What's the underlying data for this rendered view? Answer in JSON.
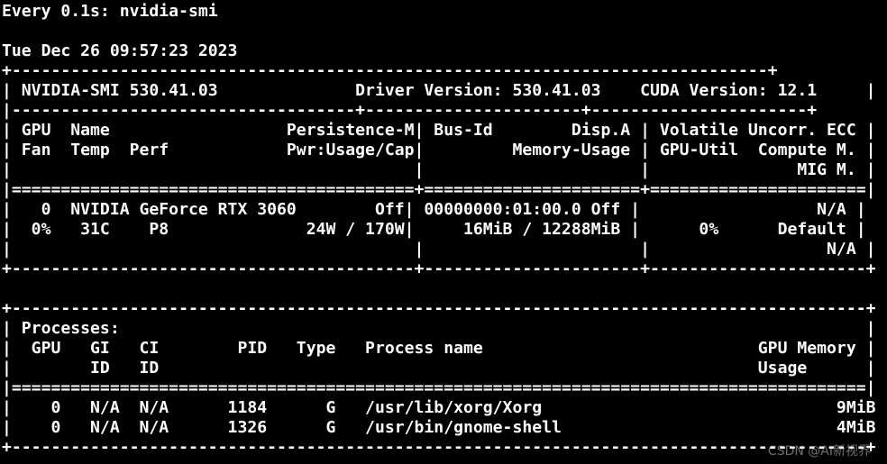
{
  "header": {
    "watch_command": "Every 0.1s: nvidia-smi",
    "timestamp": "Tue Dec 26 09:57:23 2023"
  },
  "gpu_table": {
    "border_top": "+-----------------------------------------------------------------------------+",
    "version_line": "| NVIDIA-SMI 530.41.03              Driver Version: 530.41.03    CUDA Version: 12.1     |",
    "separator": "|-----------------------------------+----------------------+----------------------+",
    "header_row_1": "| GPU  Name                  Persistence-M| Bus-Id        Disp.A | Volatile Uncorr. ECC |",
    "header_row_2": "| Fan  Temp  Perf            Pwr:Usage/Cap|         Memory-Usage | GPU-Util  Compute M. |",
    "header_row_3": "|                                         |                      |               MIG M. |",
    "double_separator": "|=========================================+======================+======================|",
    "gpu_row_1": "|   0  NVIDIA GeForce RTX 3060        Off| 00000000:01:00.0 Off |                  N/A |",
    "gpu_row_2": "|  0%   31C    P8              24W / 170W|     16MiB / 12288MiB |      0%      Default |",
    "gpu_row_3": "|                                         |                      |                  N/A |",
    "border_bottom": "+-----------------------------------------+----------------------+----------------------+"
  },
  "process_table": {
    "border_top": "+---------------------------------------------------------------------------------------+",
    "title_row": "| Processes:                                                                            |",
    "header_row_1": "|  GPU   GI   CI        PID   Type   Process name                            GPU Memory |",
    "header_row_2": "|        ID   ID                                                             Usage      |",
    "double_separator": "|=======================================================================================|",
    "rows": [
      "|    0   N/A  N/A      1184      G   /usr/lib/xorg/Xorg                              9MiB |",
      "|    0   N/A  N/A      1326      G   /usr/bin/gnome-shell                            4MiB |"
    ],
    "border_bottom": "+---------------------------------------------------------------------------------------+"
  },
  "watermark": "CSDN @AI新视界",
  "colors": {
    "background": "#000000",
    "foreground": "#ffffff"
  }
}
